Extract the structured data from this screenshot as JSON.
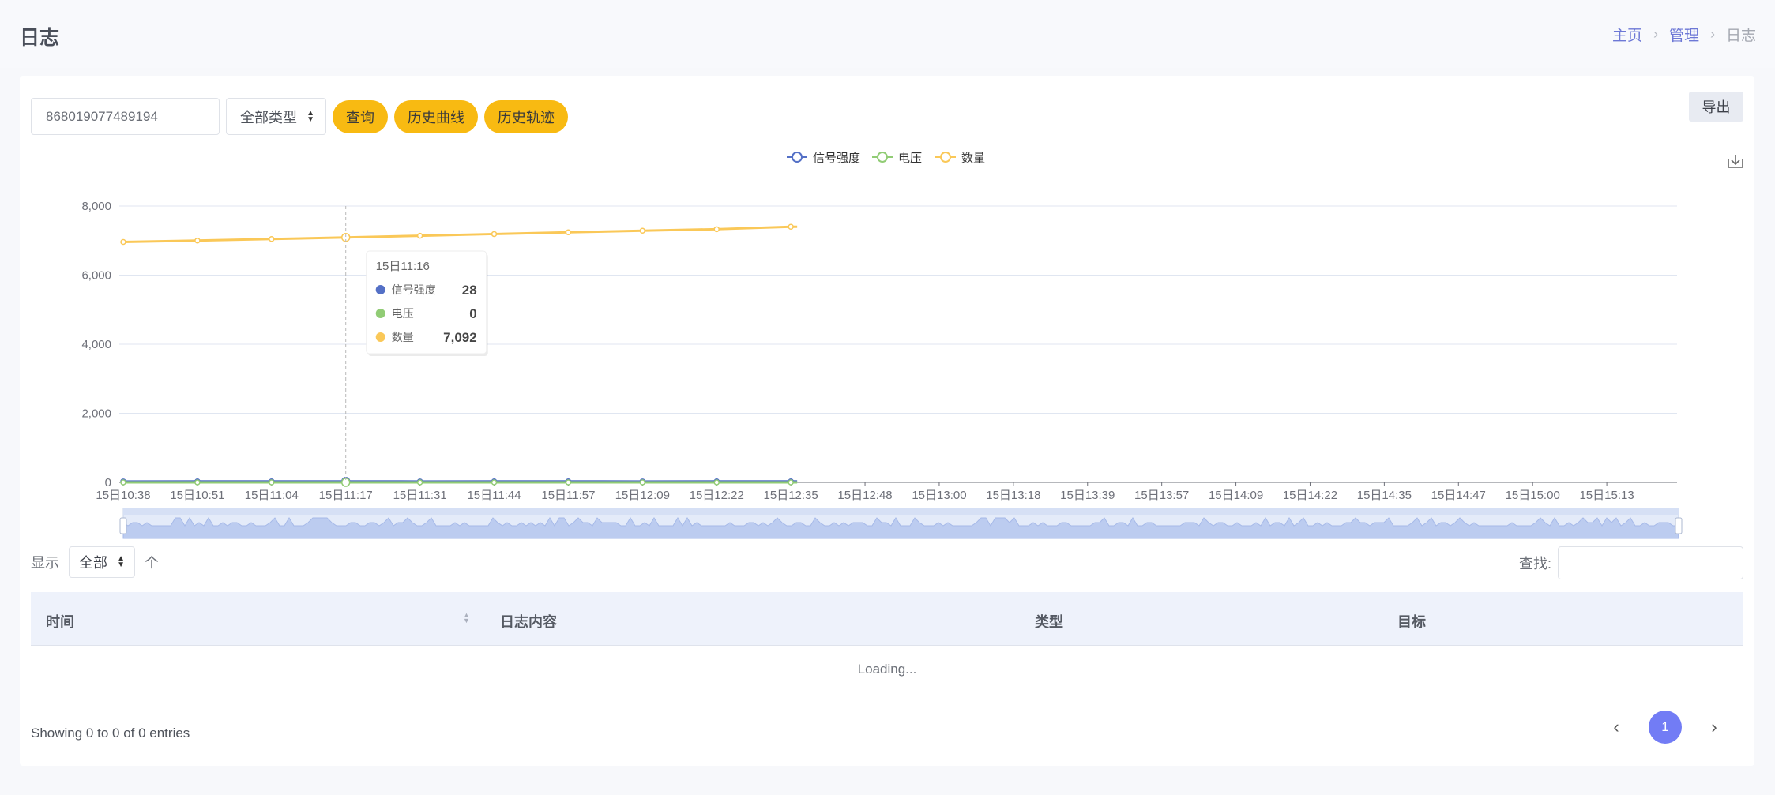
{
  "header": {
    "title": "日志",
    "breadcrumb": [
      "主页",
      "管理",
      "日志"
    ]
  },
  "toolbar": {
    "device_id": "868019077489194",
    "type_select": "全部类型",
    "query_label": "查询",
    "history_curve_label": "历史曲线",
    "history_track_label": "历史轨迹",
    "export_label": "导出"
  },
  "chart_data": {
    "type": "line",
    "x": [
      "15日10:38",
      "15日10:51",
      "15日11:04",
      "15日11:17",
      "15日11:31",
      "15日11:44",
      "15日11:57",
      "15日12:09",
      "15日12:22",
      "15日12:35"
    ],
    "x_axis_ticks": [
      "15日10:38",
      "15日10:51",
      "15日11:04",
      "15日11:17",
      "15日11:31",
      "15日11:44",
      "15日11:57",
      "15日12:09",
      "15日12:22",
      "15日12:35",
      "15日12:48",
      "15日13:00",
      "15日13:18",
      "15日13:39",
      "15日13:57",
      "15日14:09",
      "15日14:22",
      "15日14:35",
      "15日14:47",
      "15日15:00",
      "15日15:13"
    ],
    "series": [
      {
        "name": "信号强度",
        "color": "#5470c6",
        "values": [
          27,
          28,
          28,
          28,
          27,
          28,
          28,
          27,
          28,
          28
        ]
      },
      {
        "name": "电压",
        "color": "#91cc75",
        "values": [
          0,
          0,
          0,
          0,
          0,
          0,
          0,
          0,
          0,
          0
        ]
      },
      {
        "name": "数量",
        "color": "#fac858",
        "values": [
          6960,
          7000,
          7045,
          7092,
          7140,
          7190,
          7240,
          7285,
          7330,
          7400
        ]
      }
    ],
    "ylim": [
      0,
      8000
    ],
    "y_ticks": [
      0,
      2000,
      4000,
      6000,
      8000
    ],
    "y_tick_labels": [
      "0",
      "2,000",
      "4,000",
      "6,000",
      "8,000"
    ],
    "grid": true,
    "legend": "top-center",
    "tooltip": {
      "title": "15日11:16",
      "rows": [
        {
          "name": "信号强度",
          "value": "28",
          "color": "#5470c6"
        },
        {
          "name": "电压",
          "value": "0",
          "color": "#91cc75"
        },
        {
          "name": "数量",
          "value": "7,092",
          "color": "#fac858"
        }
      ]
    }
  },
  "table": {
    "length_prefix": "显示",
    "length_value": "全部",
    "length_suffix": "个",
    "search_label": "查找:",
    "columns": [
      "时间",
      "日志内容",
      "类型",
      "目标"
    ],
    "loading_text": "Loading...",
    "info_text": "Showing 0 to 0 of 0 entries",
    "current_page": "1"
  }
}
